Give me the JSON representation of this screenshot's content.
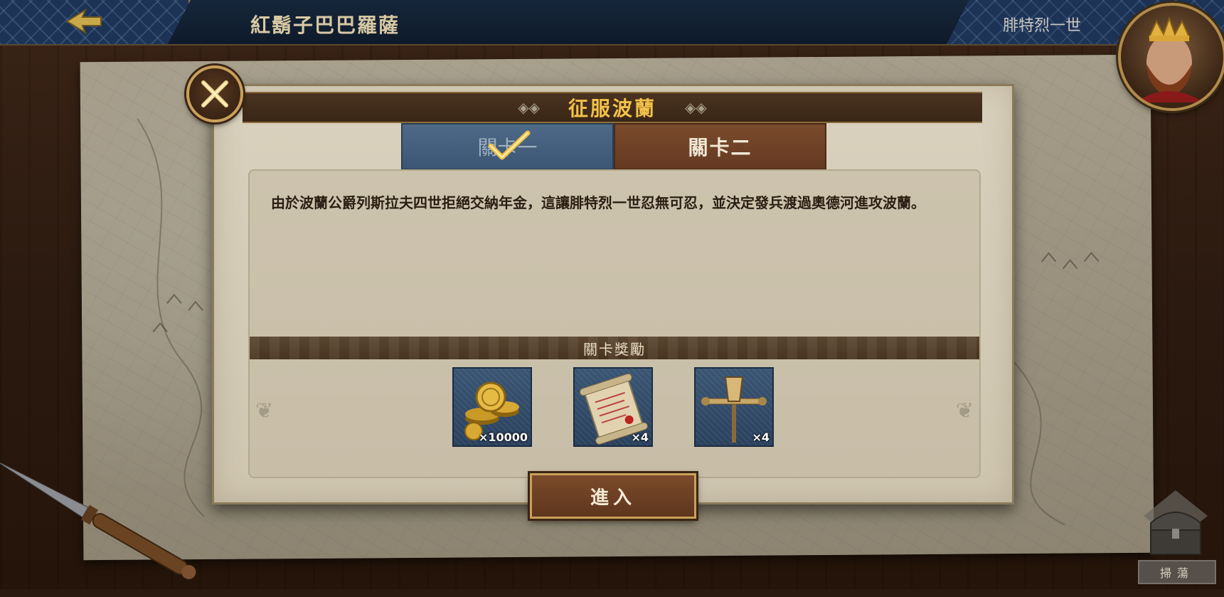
{
  "top_bar": {
    "title": "紅鬍子巴巴羅薩",
    "player_name": "腓特烈一世"
  },
  "dialog": {
    "title": "征服波蘭",
    "tabs": [
      {
        "label": "關卡一",
        "completed": true
      },
      {
        "label": "關卡二",
        "selected": true
      }
    ],
    "description": "由於波蘭公爵列斯拉夫四世拒絕交納年金，這讓腓特烈一世忍無可忍，並決定發兵渡過奧德河進攻波蘭。",
    "rewards_title": "關卡獎勵",
    "rewards": [
      {
        "icon": "gold-coins-icon",
        "quantity": "×10000"
      },
      {
        "icon": "scroll-icon",
        "quantity": "×4"
      },
      {
        "icon": "siege-tool-icon",
        "quantity": "×4"
      }
    ],
    "enter_label": "進入"
  },
  "chest": {
    "label": "掃蕩"
  },
  "colors": {
    "title_gold": "#f2c14a",
    "tab_blue": "#4e6987",
    "tab_brown": "#7a4a2c"
  }
}
